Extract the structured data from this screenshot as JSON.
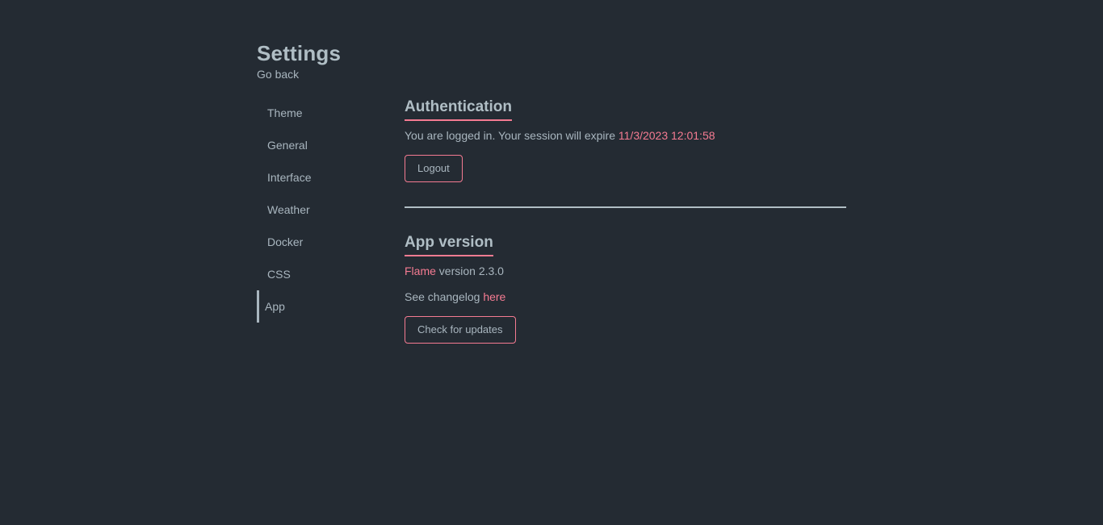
{
  "page": {
    "title": "Settings",
    "go_back": "Go back"
  },
  "sidebar": {
    "items": [
      {
        "label": "Theme",
        "active": false
      },
      {
        "label": "General",
        "active": false
      },
      {
        "label": "Interface",
        "active": false
      },
      {
        "label": "Weather",
        "active": false
      },
      {
        "label": "Docker",
        "active": false
      },
      {
        "label": "CSS",
        "active": false
      },
      {
        "label": "App",
        "active": true
      }
    ]
  },
  "auth": {
    "title": "Authentication",
    "text_prefix": "You are logged in. Your session will expire",
    "expiry": "11/3/2023 12:01:58",
    "logout_label": "Logout"
  },
  "app_version": {
    "title": "App version",
    "app_name": "Flame",
    "version_text": "version 2.3.0",
    "changelog_prefix": "See changelog",
    "changelog_link": "here",
    "check_updates_label": "Check for updates"
  },
  "colors": {
    "background": "#242b33",
    "text": "#a9b6bf",
    "accent": "#f57b92"
  }
}
